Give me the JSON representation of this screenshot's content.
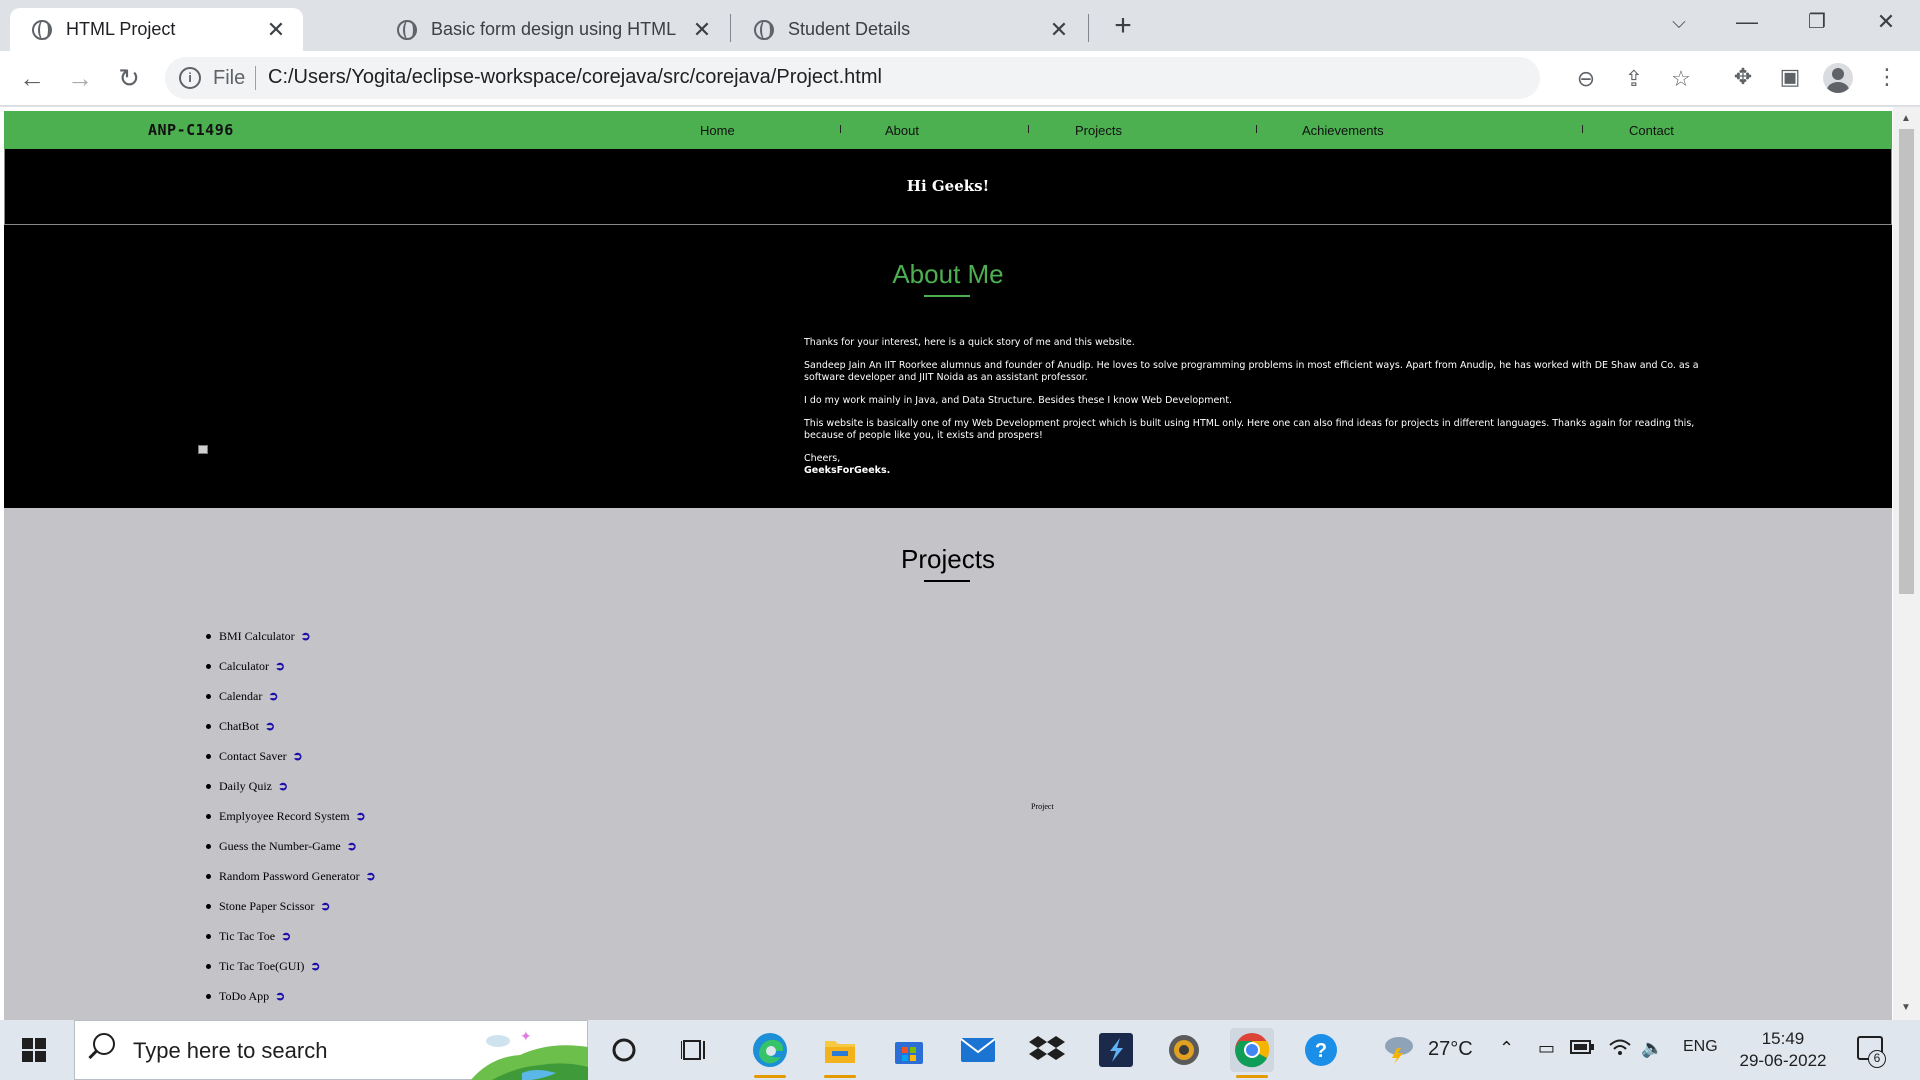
{
  "browser": {
    "tabs": [
      {
        "title": "HTML Project",
        "icon": "globe-icon",
        "active": true
      },
      {
        "title": "Basic form design using HTML",
        "icon": "globe-icon",
        "active": false
      },
      {
        "title": "Student Details",
        "icon": "globe-icon",
        "active": false
      }
    ],
    "address": {
      "scheme_label": "File",
      "url": "C:/Users/Yogita/eclipse-workspace/corejava/src/corejava/Project.html"
    }
  },
  "page": {
    "nav": {
      "logo": "ANP-C1496",
      "links": [
        "Home",
        "About",
        "Projects",
        "Achievements",
        "Contact"
      ],
      "accent_color": "#4caf50"
    },
    "greeting": "Hi Geeks!",
    "about": {
      "title": "About Me",
      "paragraphs": [
        "Thanks for your interest, here is a quick story of me and this website.",
        "Sandeep Jain An IIT Roorkee alumnus and founder of Anudip. He loves to solve programming problems in most efficient ways. Apart from Anudip, he has worked with DE Shaw and Co. as a software developer and JIIT Noida as an assistant professor.",
        "I do my work mainly in Java, and Data Structure. Besides these I know Web Development.",
        "This website is basically one of my Web Development project which is built using HTML only. Here one can also find ideas for projects in different languages. Thanks again for reading this, because of people like you, it exists and prospers!"
      ],
      "sign_off": "Cheers,",
      "signature": "GeeksForGeeks."
    },
    "projects": {
      "title": "Projects",
      "link_glyph": "➲",
      "items": [
        "BMI Calculator",
        "Calculator",
        "Calendar",
        "ChatBot",
        "Contact Saver",
        "Daily Quiz",
        "Emplyoyee Record System",
        "Guess the Number-Game",
        "Random Password Generator",
        "Stone Paper Scissor",
        "Tic Tac Toe",
        "Tic Tac Toe(GUI)",
        "ToDo App"
      ],
      "image_alt": "Project"
    }
  },
  "taskbar": {
    "search_placeholder": "Type here to search",
    "weather": "27°C",
    "language": "ENG",
    "time": "15:49",
    "date": "29-06-2022",
    "notification_count": "6"
  }
}
